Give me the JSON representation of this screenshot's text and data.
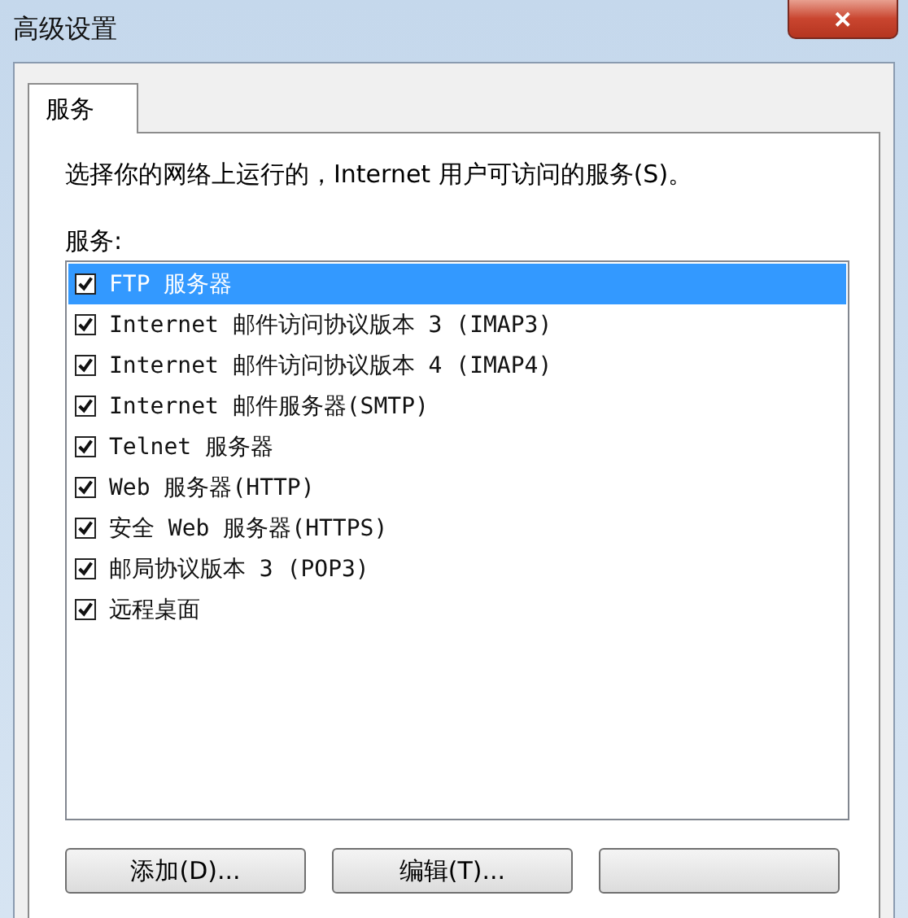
{
  "window": {
    "title": "高级设置",
    "close": "✕"
  },
  "tabs": [
    {
      "label": "服务",
      "selected": true
    }
  ],
  "description": "选择你的网络上运行的，Internet 用户可访问的服务(S)。",
  "list_label": "服务:",
  "services": [
    {
      "label": "FTP 服务器",
      "checked": true,
      "selected": true
    },
    {
      "label": "Internet 邮件访问协议版本 3 (IMAP3)",
      "checked": true,
      "selected": false
    },
    {
      "label": "Internet 邮件访问协议版本 4 (IMAP4)",
      "checked": true,
      "selected": false
    },
    {
      "label": "Internet 邮件服务器(SMTP)",
      "checked": true,
      "selected": false
    },
    {
      "label": "Telnet 服务器",
      "checked": true,
      "selected": false
    },
    {
      "label": "Web 服务器(HTTP)",
      "checked": true,
      "selected": false
    },
    {
      "label": "安全 Web 服务器(HTTPS)",
      "checked": true,
      "selected": false
    },
    {
      "label": "邮局协议版本 3 (POP3)",
      "checked": true,
      "selected": false
    },
    {
      "label": "远程桌面",
      "checked": true,
      "selected": false
    }
  ],
  "buttons": [
    "添加(D)...",
    "编辑(T)..."
  ]
}
